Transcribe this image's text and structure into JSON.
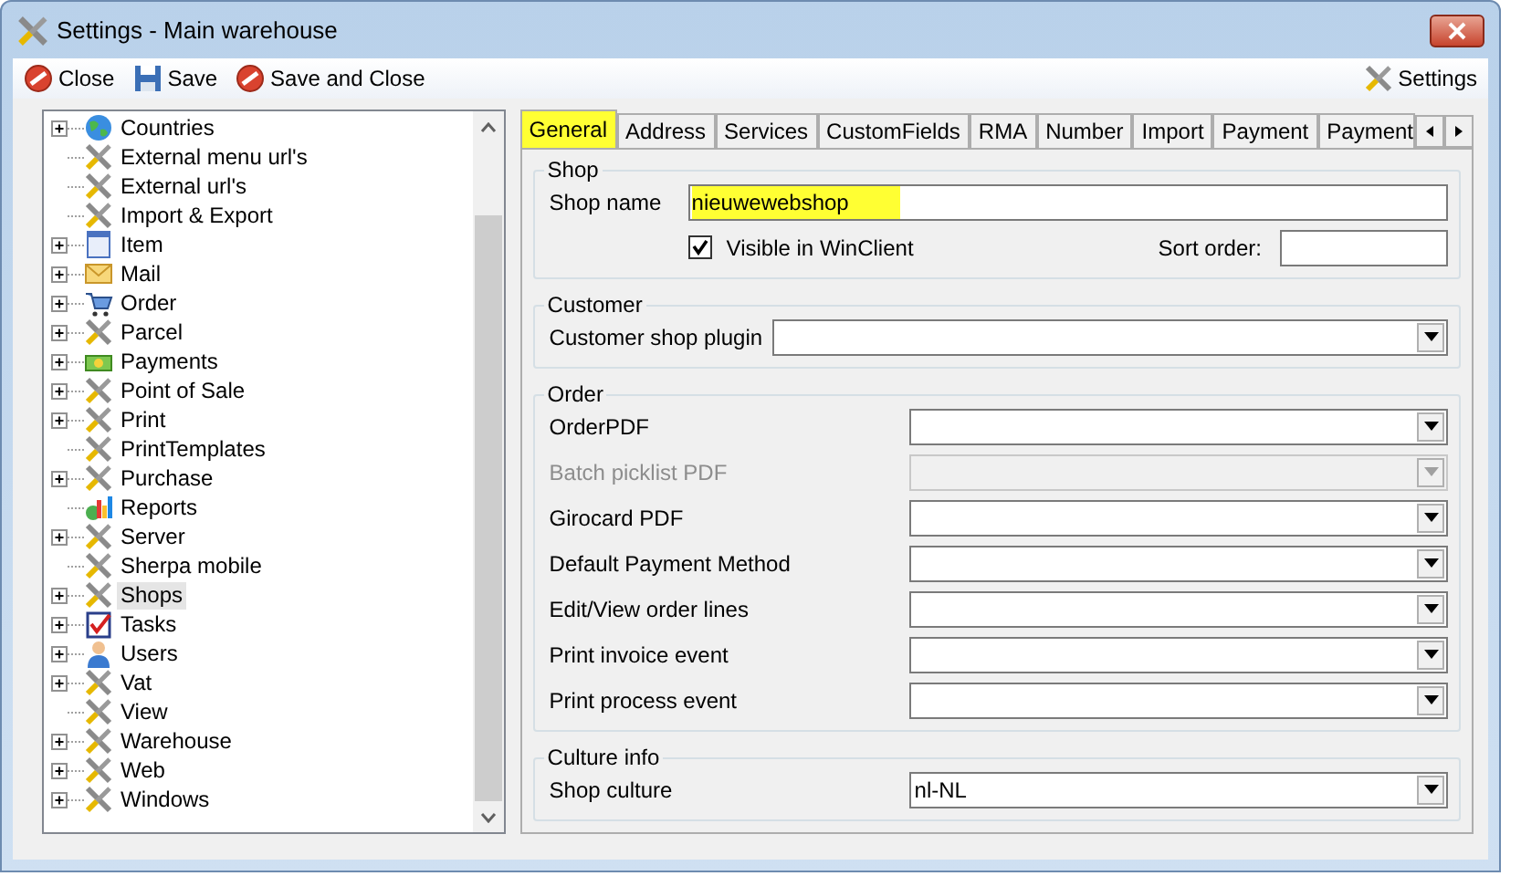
{
  "window": {
    "title": "Settings - Main warehouse"
  },
  "toolbar": {
    "buttons": [
      {
        "label": "Close",
        "kind": "close"
      },
      {
        "label": "Save",
        "kind": "save"
      },
      {
        "label": "Save and Close",
        "kind": "close"
      }
    ],
    "settings_button": {
      "label": "Settings"
    }
  },
  "tree": {
    "items": [
      {
        "label": "Countries",
        "kind": "globe",
        "expandable": true,
        "selected": false
      },
      {
        "label": "External menu url's",
        "kind": "tools",
        "expandable": false,
        "selected": false
      },
      {
        "label": "External url's",
        "kind": "tools",
        "expandable": false,
        "selected": false
      },
      {
        "label": "Import & Export",
        "kind": "tools",
        "expandable": false,
        "selected": false
      },
      {
        "label": "Item",
        "kind": "item",
        "expandable": true,
        "selected": false
      },
      {
        "label": "Mail",
        "kind": "mail",
        "expandable": true,
        "selected": false
      },
      {
        "label": "Order",
        "kind": "cart",
        "expandable": true,
        "selected": false
      },
      {
        "label": "Parcel",
        "kind": "tools",
        "expandable": true,
        "selected": false
      },
      {
        "label": "Payments",
        "kind": "money",
        "expandable": true,
        "selected": false
      },
      {
        "label": "Point of Sale",
        "kind": "tools",
        "expandable": true,
        "selected": false
      },
      {
        "label": "Print",
        "kind": "tools",
        "expandable": true,
        "selected": false
      },
      {
        "label": "PrintTemplates",
        "kind": "tools",
        "expandable": false,
        "selected": false
      },
      {
        "label": "Purchase",
        "kind": "tools",
        "expandable": true,
        "selected": false
      },
      {
        "label": "Reports",
        "kind": "chart",
        "expandable": false,
        "selected": false
      },
      {
        "label": "Server",
        "kind": "tools",
        "expandable": true,
        "selected": false
      },
      {
        "label": "Sherpa mobile",
        "kind": "tools",
        "expandable": false,
        "selected": false
      },
      {
        "label": "Shops",
        "kind": "tools",
        "expandable": true,
        "selected": true
      },
      {
        "label": "Tasks",
        "kind": "tasks",
        "expandable": true,
        "selected": false
      },
      {
        "label": "Users",
        "kind": "user",
        "expandable": true,
        "selected": false
      },
      {
        "label": "Vat",
        "kind": "tools",
        "expandable": true,
        "selected": false
      },
      {
        "label": "View",
        "kind": "tools",
        "expandable": false,
        "selected": false
      },
      {
        "label": "Warehouse",
        "kind": "tools",
        "expandable": true,
        "selected": false
      },
      {
        "label": "Web",
        "kind": "tools",
        "expandable": true,
        "selected": false
      },
      {
        "label": "Windows",
        "kind": "tools",
        "expandable": true,
        "selected": false
      }
    ]
  },
  "tabs": [
    {
      "label": "General",
      "selected": true,
      "highlighted": true
    },
    {
      "label": "Address",
      "selected": false,
      "highlighted": false
    },
    {
      "label": "Services",
      "selected": false,
      "highlighted": false
    },
    {
      "label": "CustomFields",
      "selected": false,
      "highlighted": false
    },
    {
      "label": "RMA",
      "selected": false,
      "highlighted": false
    },
    {
      "label": "Number",
      "selected": false,
      "highlighted": false
    },
    {
      "label": "Import",
      "selected": false,
      "highlighted": false
    },
    {
      "label": "Payment",
      "selected": false,
      "highlighted": false
    },
    {
      "label": "Payment",
      "selected": false,
      "highlighted": false
    }
  ],
  "groups": [
    {
      "title": "Shop",
      "kind": "shop",
      "shop_name": {
        "label": "Shop name",
        "value": "nieuwewebshop",
        "highlighted": true
      },
      "visible": {
        "label": "Visible in WinClient",
        "checked": true
      },
      "sort_order": {
        "label": "Sort order:"
      }
    },
    {
      "title": "Customer",
      "kind": "fields",
      "fields": [
        {
          "label": "Customer shop plugin",
          "disabled": false
        }
      ]
    },
    {
      "title": "Order",
      "kind": "fields",
      "fields": [
        {
          "label": "OrderPDF",
          "disabled": false
        },
        {
          "label": "Batch picklist PDF",
          "disabled": true
        },
        {
          "label": "Girocard PDF",
          "disabled": false
        },
        {
          "label": "Default Payment Method",
          "disabled": false
        },
        {
          "label": "Edit/View order lines",
          "disabled": false
        },
        {
          "label": "Print invoice event",
          "disabled": false
        },
        {
          "label": "Print process event",
          "disabled": false
        }
      ]
    },
    {
      "title": "Culture info",
      "kind": "fields",
      "fields": [
        {
          "label": "Shop culture",
          "value": "nl-NL",
          "disabled": false
        }
      ]
    }
  ]
}
